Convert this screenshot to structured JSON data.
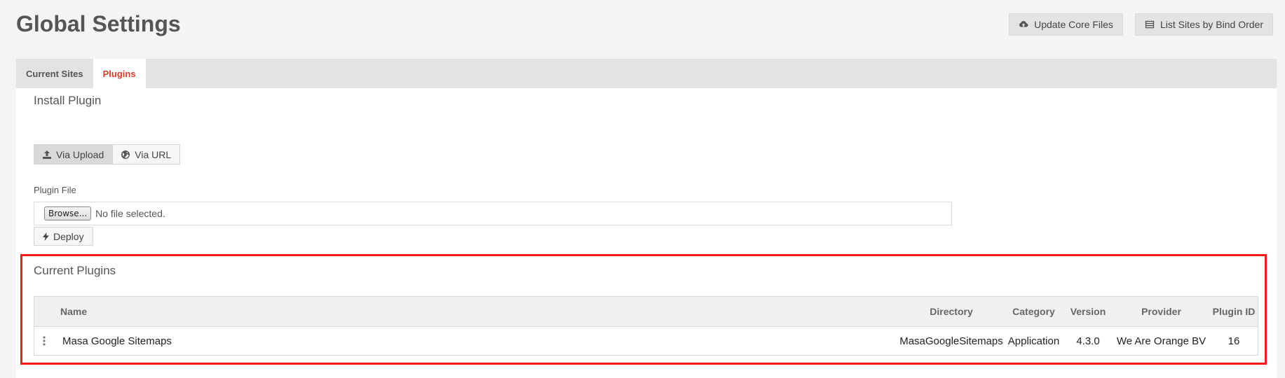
{
  "header": {
    "title": "Global Settings",
    "actions": {
      "update_core": "Update Core Files",
      "list_sites": "List Sites by Bind Order"
    }
  },
  "tabs": [
    {
      "label": "Current Sites",
      "active": false
    },
    {
      "label": "Plugins",
      "active": true
    }
  ],
  "install": {
    "title": "Install Plugin",
    "modes": {
      "upload": "Via Upload",
      "url": "Via URL",
      "selected": "upload"
    },
    "field_label": "Plugin File",
    "browse_label": "Browse...",
    "file_status": "No file selected.",
    "deploy_label": "Deploy"
  },
  "current_plugins": {
    "title": "Current Plugins",
    "columns": {
      "name": "Name",
      "directory": "Directory",
      "category": "Category",
      "version": "Version",
      "provider": "Provider",
      "plugin_id": "Plugin ID"
    },
    "rows": [
      {
        "name": "Masa Google Sitemaps",
        "directory": "MasaGoogleSitemaps",
        "category": "Application",
        "version": "4.3.0",
        "provider": "We Are Orange BV",
        "plugin_id": "16"
      }
    ]
  },
  "colors": {
    "accent": "#e03a2b",
    "highlight_box": "#ff1a1a"
  },
  "icons": {
    "update_core": "cloud-upload-icon",
    "list_sites": "list-icon",
    "via_upload": "upload-icon",
    "via_url": "globe-icon",
    "deploy": "bolt-icon",
    "row_handle": "vertical-ellipsis-icon"
  }
}
